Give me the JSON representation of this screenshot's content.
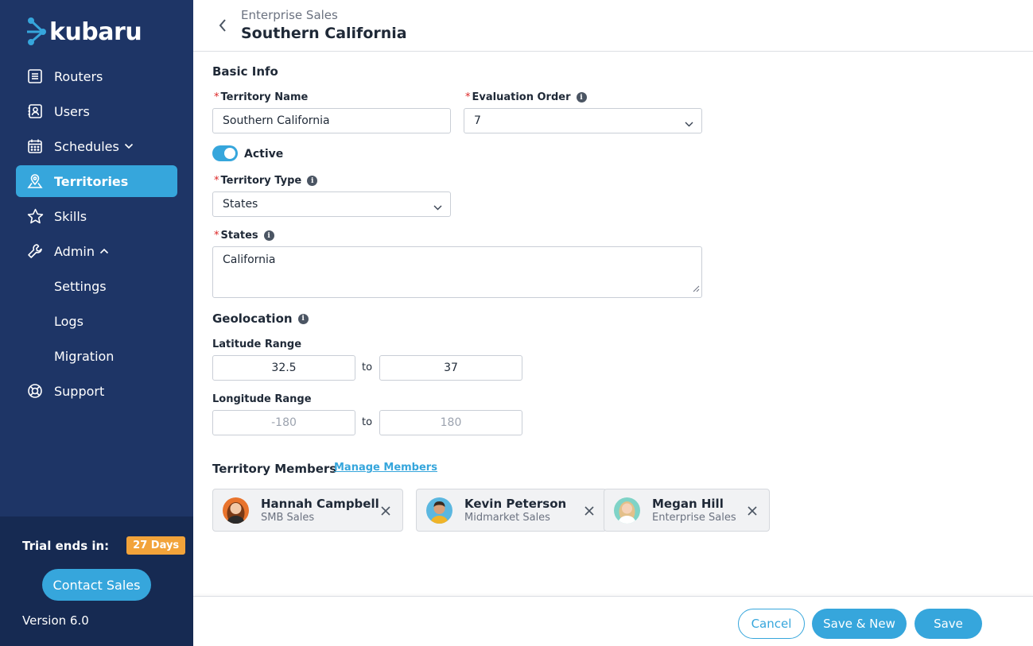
{
  "app": {
    "logo_text": "kubaru"
  },
  "sidebar": {
    "items": [
      {
        "label": "Routers",
        "icon": "list-icon"
      },
      {
        "label": "Users",
        "icon": "contacts-icon"
      },
      {
        "label": "Schedules",
        "icon": "calendar-icon"
      },
      {
        "label": "Territories",
        "icon": "map-pin-icon"
      },
      {
        "label": "Skills",
        "icon": "star-icon"
      },
      {
        "label": "Admin",
        "icon": "wrench-icon"
      },
      {
        "label": "Settings"
      },
      {
        "label": "Logs"
      },
      {
        "label": "Migration"
      },
      {
        "label": "Support",
        "icon": "lifebuoy-icon"
      }
    ],
    "trial_label": "Trial ends in:",
    "trial_badge": "27 Days",
    "contact_label": "Contact Sales",
    "version": "Version 6.0"
  },
  "header": {
    "breadcrumb": "Enterprise Sales",
    "title": "Southern California"
  },
  "form": {
    "basic_info_title": "Basic Info",
    "territory_name_label": "Territory Name",
    "territory_name_value": "Southern California",
    "evaluation_order_label": "Evaluation Order",
    "evaluation_order_value": "7",
    "active_label": "Active",
    "territory_type_label": "Territory Type",
    "territory_type_value": "States",
    "states_label": "States",
    "states_value": "California",
    "geolocation_title": "Geolocation",
    "latitude_label": "Latitude Range",
    "latitude_min": "32.5",
    "latitude_max": "37",
    "longitude_label": "Longitude Range",
    "longitude_min_placeholder": "-180",
    "longitude_max_placeholder": "180",
    "to_label": "to",
    "members_title": "Territory Members",
    "manage_members_label": "Manage Members",
    "members": [
      {
        "name": "Hannah Campbell",
        "role": "SMB Sales"
      },
      {
        "name": "Kevin Peterson",
        "role": "Midmarket Sales"
      },
      {
        "name": "Megan Hill",
        "role": "Enterprise Sales"
      }
    ]
  },
  "footer": {
    "cancel_label": "Cancel",
    "save_new_label": "Save & New",
    "save_label": "Save"
  },
  "colors": {
    "sidebar_bg": "#1e3566",
    "accent": "#36a6dc",
    "trial_badge": "#f2a33a",
    "required": "#dc2626"
  }
}
